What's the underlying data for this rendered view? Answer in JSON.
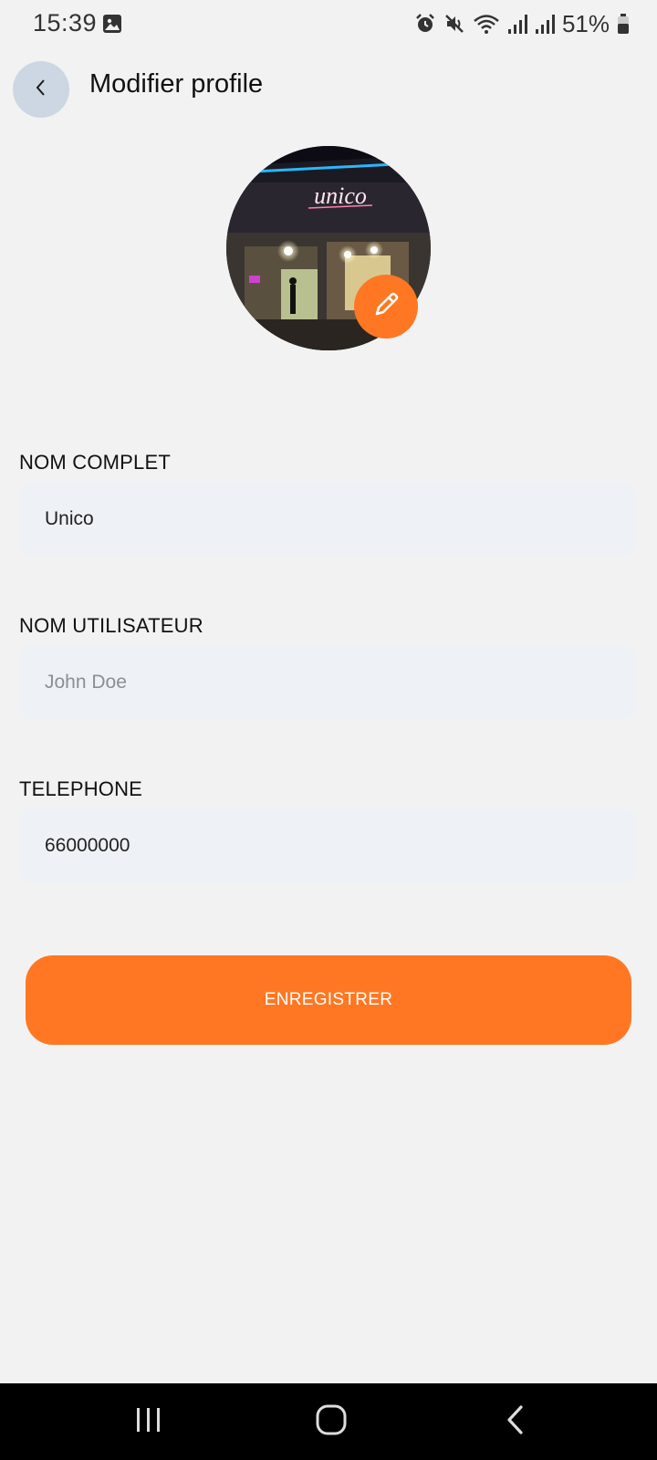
{
  "status_bar": {
    "time": "15:39",
    "battery_percent": "51%",
    "icons": [
      "gallery-icon",
      "alarm-icon",
      "mute-icon",
      "wifi-icon",
      "signal-icon",
      "signal-icon",
      "battery-icon"
    ]
  },
  "header": {
    "title": "Modifier profile",
    "back_icon": "chevron-left-icon"
  },
  "avatar": {
    "sign_text": "unico",
    "edit_icon": "pencil-icon"
  },
  "form": {
    "full_name": {
      "label": "NOM COMPLET",
      "value": "Unico"
    },
    "username": {
      "label": "NOM UTILISATEUR",
      "placeholder": "John Doe"
    },
    "phone": {
      "label": "TELEPHONE",
      "value": "66000000"
    },
    "save_label": "ENREGISTRER"
  },
  "colors": {
    "accent": "#ff7722",
    "background": "#f2f2f2",
    "input_background": "#eef2f6",
    "back_button": "#cdd7e3"
  },
  "nav_bar": {
    "icons": [
      "recent-apps-icon",
      "home-icon",
      "back-icon"
    ]
  }
}
